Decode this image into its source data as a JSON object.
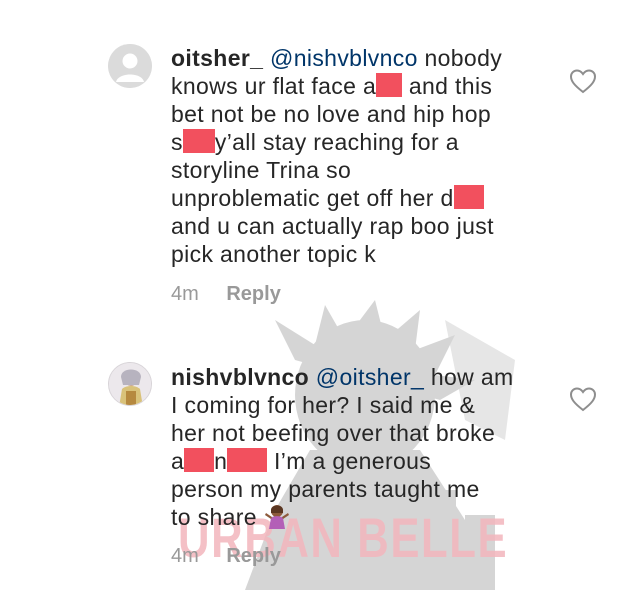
{
  "watermark": {
    "text": "URBAN BELLE"
  },
  "comments": [
    {
      "username": "oitsher_",
      "lines": {
        "l1_mention": "@nishvblvnco",
        "l1_rest": " nobody",
        "l2_a": "knows ur flat face a",
        "l2_b": " and this",
        "l3": "bet not be no love and hip hop",
        "l4_a": "s",
        "l4_b": "y’all stay reaching for a",
        "l5": "storyline Trina so",
        "l6_a": "unproblematic get off her d",
        "l7": "and u can actually rap boo just",
        "l8": "pick another topic k"
      },
      "time": "4m",
      "reply_label": "Reply",
      "avatar_icon": "default-avatar-icon",
      "like_icon": "heart-outline-icon"
    },
    {
      "username": "nishvblvnco",
      "lines": {
        "l1_mention": "@oitsher_",
        "l1_rest": " how am",
        "l2": "I coming for her? I said me &",
        "l3": "her not beefing over that broke",
        "l4_a": "a",
        "l4_b": "n",
        "l4_c": " I’m a generous",
        "l5": "person my parents taught me",
        "l6": "to share "
      },
      "emoji_icon": "woman-shrugging-emoji",
      "time": "4m",
      "reply_label": "Reply",
      "avatar_icon": "profile-photo-avatar",
      "like_icon": "heart-outline-icon"
    }
  ],
  "colors": {
    "redaction": "#f2505e",
    "meta": "#999999",
    "mention": "#003569",
    "text": "#262626"
  }
}
